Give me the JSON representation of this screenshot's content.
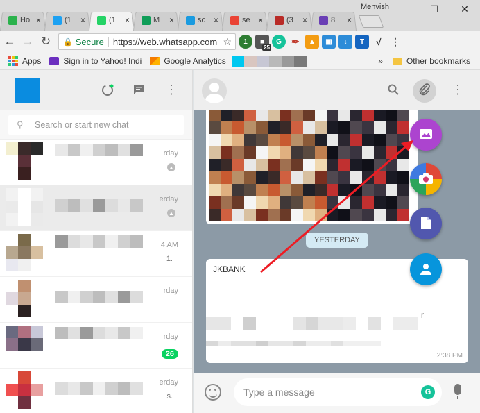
{
  "browser": {
    "user": "Mehvish",
    "tabs": [
      {
        "title": "Ho",
        "icon": "feedly-icon",
        "color": "#2bb24c"
      },
      {
        "title": "(1",
        "icon": "twitter-icon",
        "color": "#1da1f2"
      },
      {
        "title": "(1",
        "icon": "whatsapp-icon",
        "color": "#25d366",
        "active": true
      },
      {
        "title": "M",
        "icon": "sheets-icon",
        "color": "#0f9d58"
      },
      {
        "title": "sc",
        "icon": "n-icon",
        "color": "#1a9be0"
      },
      {
        "title": "se",
        "icon": "google-icon",
        "color": "#ea4335"
      },
      {
        "title": "(3",
        "icon": "quora-icon",
        "color": "#b92b27"
      },
      {
        "title": "8",
        "icon": "oe-icon",
        "color": "#6a3fb5"
      }
    ],
    "address": {
      "secure_label": "Secure",
      "url": "https://web.whatsapp.com"
    },
    "extension_badge": "25",
    "bookmarks": {
      "apps": "Apps",
      "yahoo": "Sign in to Yahoo! Indi",
      "analytics": "Google Analytics",
      "overflow": "»",
      "other": "Other bookmarks"
    }
  },
  "whatsapp": {
    "search_placeholder": "Search or start new chat",
    "chats": [
      {
        "day": "rday",
        "pinned": true
      },
      {
        "day": "erday",
        "pinned": true,
        "selected": true
      },
      {
        "day": "4 AM",
        "preview": "1."
      },
      {
        "day": "rday"
      },
      {
        "day": "rday",
        "unread": "26"
      },
      {
        "day": "erday",
        "preview": "s."
      }
    ],
    "date_divider": "YESTERDAY",
    "message": {
      "sender": "JKBANK",
      "time": "2:38 PM",
      "trailing": "r"
    },
    "compose_placeholder": "Type a message",
    "attach_menu": [
      {
        "name": "gallery",
        "color": "#ac44cf"
      },
      {
        "name": "camera",
        "color": "#d3396d"
      },
      {
        "name": "document",
        "color": "#5157ae"
      },
      {
        "name": "contact",
        "color": "#0795dc"
      }
    ],
    "accent_color": "#09d261"
  }
}
